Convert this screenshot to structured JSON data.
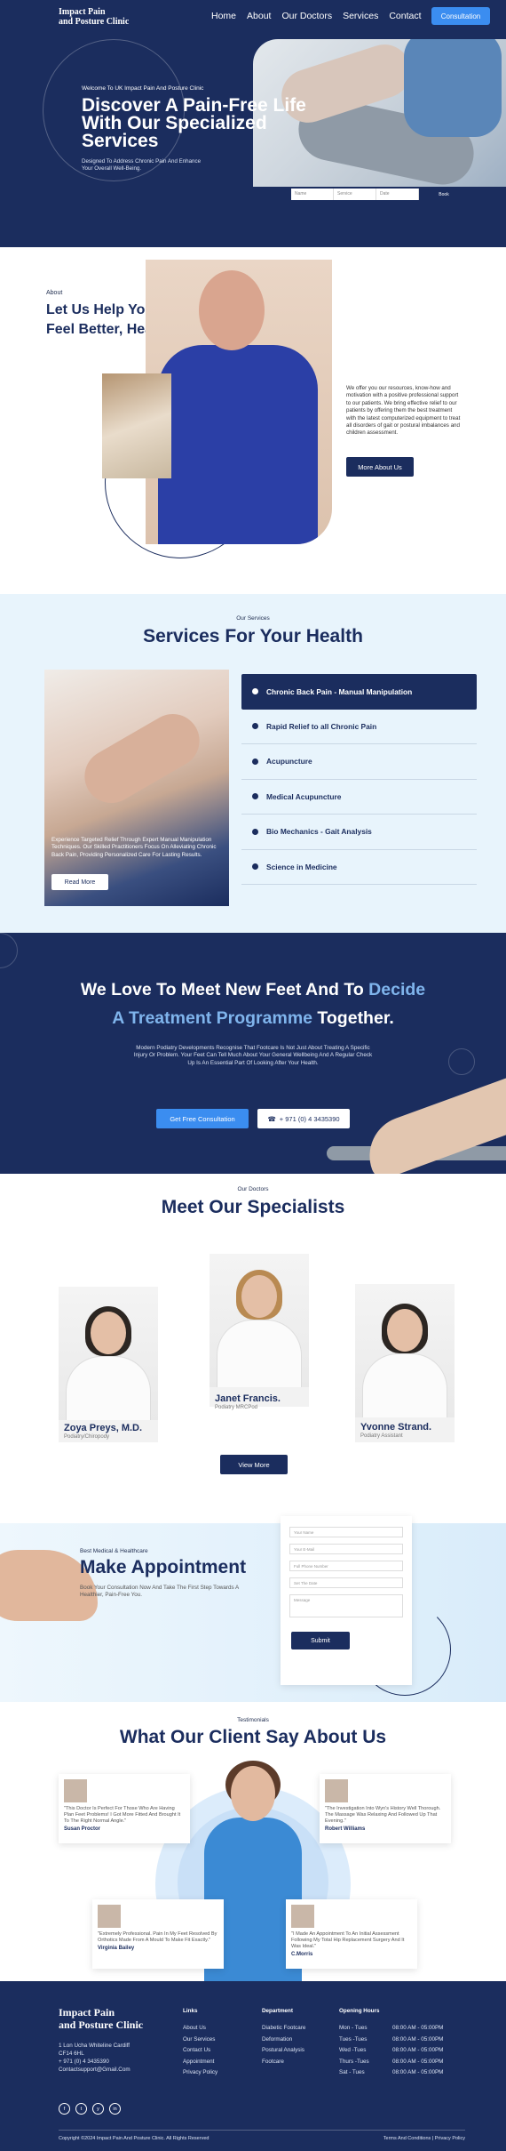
{
  "colors": {
    "navy": "#1b2d5e",
    "accent": "#3b8df0",
    "light_bg": "#e8f4fc",
    "highlight": "#7fb4ec"
  },
  "header": {
    "logo_line1": "Impact Pain",
    "logo_line2": "and Posture Clinic",
    "nav": [
      "Home",
      "About",
      "Our Doctors",
      "Services",
      "Contact"
    ],
    "cta": "Consultation"
  },
  "hero": {
    "eyebrow": "Welcome To UK Impact Pain And Posture Clinic",
    "title": "Discover A Pain-Free Life With Our Specialized Services",
    "description": "Designed To Address Chronic Pain And Enhance Your Overall Well-Being.",
    "search_fields": [
      "Name",
      "Service",
      "Date"
    ],
    "search_button": "Book"
  },
  "about": {
    "label": "About",
    "title_line1": "Let Us Help You",
    "title_line2": "Feel Better, Head To Toe.",
    "text": "We offer you our resources, know-how and motivation with a positive professional support to our patients. We bring effective relief to our patients by offering them the best treatment with the latest computerized equipment to treat all disorders of gait or postural imbalances and children assessment.",
    "button": "More About Us"
  },
  "services": {
    "label": "Our Services",
    "title": "Services For Your Health",
    "image_text": "Experience Targeted Relief Through Expert Manual Manipulation Techniques. Our Skilled Practitioners Focus On Alleviating Chronic Back Pain, Providing Personalized Care For Lasting Results.",
    "read_more": "Read More",
    "items": [
      "Chronic Back Pain - Manual Manipulation",
      "Rapid Relief to all Chronic Pain",
      "Acupuncture",
      "Medical Acupuncture",
      "Bio Mechanics - Gait Analysis",
      "Science in Medicine"
    ],
    "active_index": 0
  },
  "banner": {
    "title_a": "We Love To Meet New Feet And To ",
    "title_hl1": "Decide",
    "title_hl2": "A Treatment Programme",
    "title_b": " Together.",
    "text": "Modern Podiatry Developments Recognise That Footcare Is Not Just About Treating A Specific Injury Or Problem. Your Feet Can Tell Much About Your General Wellbeing And A Regular Check Up Is An Essential Part Of Looking After Your Health.",
    "btn_consult": "Get Free Consultation",
    "btn_phone": "+ 971 (0) 4 3435390"
  },
  "team": {
    "label": "Our Doctors",
    "title": "Meet Our Specialists",
    "doctors": [
      {
        "name": "Zoya Preys, M.D.",
        "role": "Podiatry/Chiropody"
      },
      {
        "name": "Janet Francis.",
        "role": "Podiatry MRCPod"
      },
      {
        "name": "Yvonne Strand.",
        "role": "Podiatry Assistant"
      }
    ],
    "button": "View More"
  },
  "appointment": {
    "label": "Best Medical & Healthcare",
    "title": "Make Appointment",
    "text": "Book Your Consultation Now And Take The First Step Towards A Healthier, Pain-Free You.",
    "fields": [
      "Your Name",
      "Your E-Mail",
      "Full Phone Number",
      "Set The Date",
      "Message"
    ],
    "submit": "Submit"
  },
  "testimonials": {
    "label": "Testimonials",
    "title": "What Our Client Say About Us",
    "cards": [
      {
        "quote": "\"This Doctor Is Perfect For Those Who Are Having Plan Feet Problems! I Got More Fitted And Brought It To The Right Normal Angle.\"",
        "name": "Susan Proctor"
      },
      {
        "quote": "\"The Investigation Into Wyn's History Well Thorough. The Massage Was Relaxing And Followed Up That Evening.\"",
        "name": "Robert Williams"
      },
      {
        "quote": "\"Extremely Professional. Pain In My Feet Resolved By Orthotics Made From A Mould To Make Fit Exactly.\"",
        "name": "Virginia Bailey"
      },
      {
        "quote": "\"I Made An Appointment To An Initial Assessment Following My Total Hip Replacement Surgery And It Was Ideal.\"",
        "name": "C.Morris"
      }
    ]
  },
  "footer": {
    "logo_line1": "Impact Pain",
    "logo_line2": "and Posture Clinic",
    "address": [
      "1 Lon Ucha Whiteline Cardiff",
      "CF14 6HL"
    ],
    "phone": "+ 971 (0) 4 3435390",
    "email": "Contactsupport@Gmail.Com",
    "social": [
      "f",
      "t",
      "y",
      "in"
    ],
    "links_title": "Links",
    "links": [
      "About Us",
      "Our Services",
      "Contact Us",
      "Appointment",
      "Privacy Policy"
    ],
    "dept_title": "Department",
    "departments": [
      "Diabetic Footcare",
      "Deformation",
      "Postural Analysis",
      "Footcare"
    ],
    "hours_title": "Opening Hours",
    "hours": [
      {
        "day": "Mon - Tues",
        "time": "08:00 AM - 05:00PM"
      },
      {
        "day": "Tues -Tues",
        "time": "08:00 AM - 05:00PM"
      },
      {
        "day": "Wed -Tues",
        "time": "08:00 AM - 05:00PM"
      },
      {
        "day": "Thurs -Tues",
        "time": "08:00 AM - 05:00PM"
      },
      {
        "day": "Sat - Tues",
        "time": "08:00 AM - 05:00PM"
      }
    ],
    "copyright": "Copyright ©2024 Impact Pain And Posture Clinic. All Rights Reserved",
    "legal": "Terms And Conditions | Privacy Policy"
  }
}
